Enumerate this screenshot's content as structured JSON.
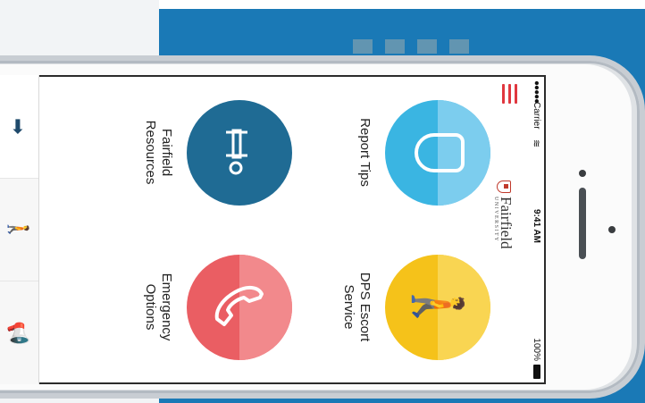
{
  "status_bar": {
    "signal": "●●●●●",
    "carrier": "Carrier",
    "wifi_icon": "wifi-icon",
    "time": "9:41 AM",
    "battery": "100%"
  },
  "header": {
    "menu_icon": "hamburger-menu-icon",
    "logo_name": "Fairfield",
    "logo_sub": "UNIVERSITY"
  },
  "tiles": [
    {
      "label": "Report Tips",
      "icon": "shield-icon",
      "color": "#3ab5e2"
    },
    {
      "label": "DPS Escort Service",
      "icon": "walking-person-icon",
      "color": "#f5c21a"
    },
    {
      "label": "Fairfield Resources",
      "icon": "key-icon",
      "color": "#1f6b94"
    },
    {
      "label": "Emergency Options",
      "icon": "phone-icon",
      "color": "#ea5e63"
    }
  ],
  "tabbar": {
    "items": [
      {
        "icon": "arrow-right-icon",
        "glyph": "➡"
      },
      {
        "icon": "walking-person-icon",
        "glyph": "🚶"
      },
      {
        "icon": "megaphone-icon",
        "glyph": "📢"
      }
    ]
  }
}
